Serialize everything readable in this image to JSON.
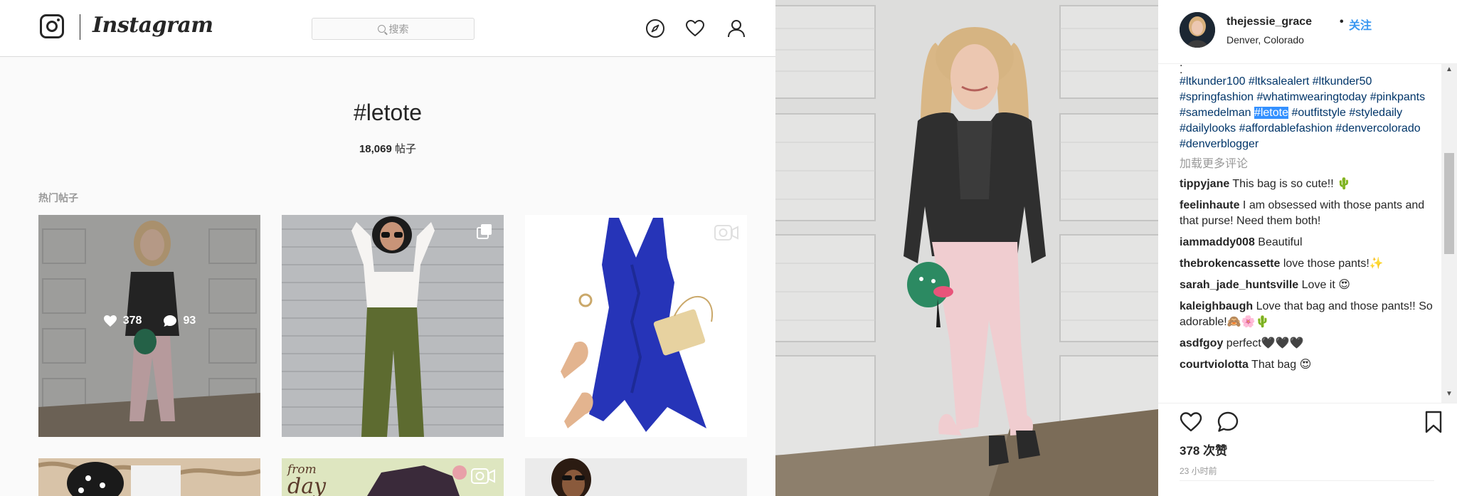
{
  "nav": {
    "logo_text": "Instagram",
    "search_placeholder": "搜索"
  },
  "tag_page": {
    "title": "#letote",
    "post_count_number": "18,069",
    "post_count_unit": "帖子",
    "section_label": "热门帖子",
    "hover_likes": "378",
    "hover_comments": "93",
    "tile5_text_line1": "from",
    "tile5_text_line2": "day"
  },
  "post": {
    "username": "thejessie_grace",
    "separator": "•",
    "follow_label": "关注",
    "location": "Denver, Colorado",
    "caption_dots": [
      ".",
      "."
    ],
    "hashtags_before": "#ltkunder100 #ltksalealert #ltkunder50 #springfashion #whatimwearingtoday #pinkpants #samedelman ",
    "hashtag_selected": "#letote",
    "hashtags_after": " #outfitstyle #styledaily #dailylooks #affordablefashion #denvercolorado #denverblogger",
    "load_more": "加载更多评论",
    "comments": [
      {
        "user": "tippyjane",
        "text": "This bag is so cute!! 🌵"
      },
      {
        "user": "feelinhaute",
        "text": "I am obsessed with those pants and that purse! Need them both!"
      },
      {
        "user": "iammaddy008",
        "text": "Beautiful"
      },
      {
        "user": "thebrokencassette",
        "text": "love those pants!✨"
      },
      {
        "user": "sarah_jade_huntsville",
        "text": "Love it 😍"
      },
      {
        "user": "kaleighbaugh",
        "text": "Love that bag and those pants!! So adorable!🙈🌸🌵"
      },
      {
        "user": "asdfgoy",
        "text": "perfect🖤🖤🖤"
      },
      {
        "user": "courtviolotta",
        "text": "That bag 😍"
      }
    ],
    "likes_label": "378 次赞",
    "timestamp": "23 小时前"
  },
  "colors": {
    "link_blue": "#3897f0",
    "hashtag_navy": "#003569",
    "text": "#262626",
    "muted": "#999999"
  }
}
